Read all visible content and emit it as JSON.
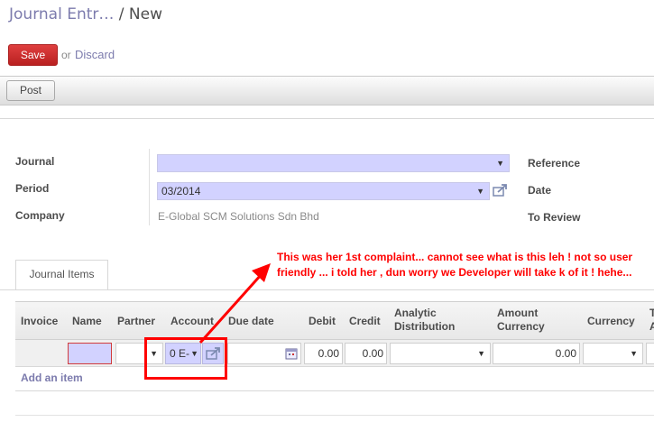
{
  "breadcrumb": {
    "parent": "Journal Entr…",
    "separator": "/",
    "current": "New"
  },
  "toolbar": {
    "save_label": "Save",
    "or_label": "or",
    "discard_label": "Discard"
  },
  "status": {
    "post_label": "Post"
  },
  "form": {
    "journal_label": "Journal",
    "journal_value": "",
    "period_label": "Period",
    "period_value": "03/2014",
    "company_label": "Company",
    "company_value": "E-Global SCM Solutions Sdn Bhd",
    "reference_label": "Reference",
    "date_label": "Date",
    "to_review_label": "To Review"
  },
  "tabs": [
    {
      "label": "Journal Items"
    }
  ],
  "grid": {
    "columns": [
      "Invoice",
      "Name",
      "Partner",
      "Account",
      "Due date",
      "Debit",
      "Credit",
      "Analytic Distribution",
      "Amount Currency",
      "Currency",
      "T A"
    ],
    "row": {
      "account": "0 E-",
      "debit": "0.00",
      "credit": "0.00",
      "amount_currency": "0.00"
    },
    "add_item_label": "Add an item"
  },
  "annotation": {
    "text": "This was her 1st complaint... cannot see what is this leh ! not so user friendly ... i told her , dun worry we Developer will take k of it ! hehe...",
    "color": "#ff0000"
  },
  "colors": {
    "accent": "#7c7bad",
    "save": "#d03232",
    "selection": "#d2d2ff"
  }
}
